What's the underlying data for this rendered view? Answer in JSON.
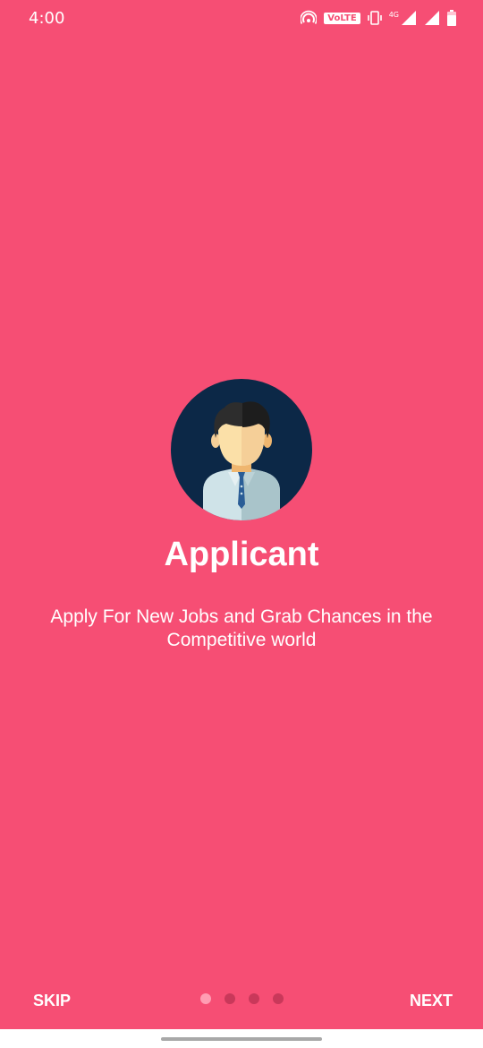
{
  "status_bar": {
    "time": "4:00",
    "volte_label": "VoLTE",
    "network_label": "4G",
    "icons": [
      "hotspot-icon",
      "volte-icon",
      "vibrate-icon",
      "signal-4g-icon",
      "signal-icon",
      "battery-icon"
    ]
  },
  "onboarding": {
    "title": "Applicant",
    "description": "Apply For New Jobs and Grab Chances in the Competitive world",
    "avatar_icon": "applicant-avatar-icon",
    "page_indicator": {
      "total": 4,
      "current": 1
    }
  },
  "footer": {
    "skip_label": "SKIP",
    "next_label": "NEXT"
  },
  "colors": {
    "background": "#f64e74",
    "text": "#ffffff",
    "dot_active": "#ff9db3",
    "dot_inactive": "#c9385a",
    "avatar_circle": "#0c2847"
  }
}
